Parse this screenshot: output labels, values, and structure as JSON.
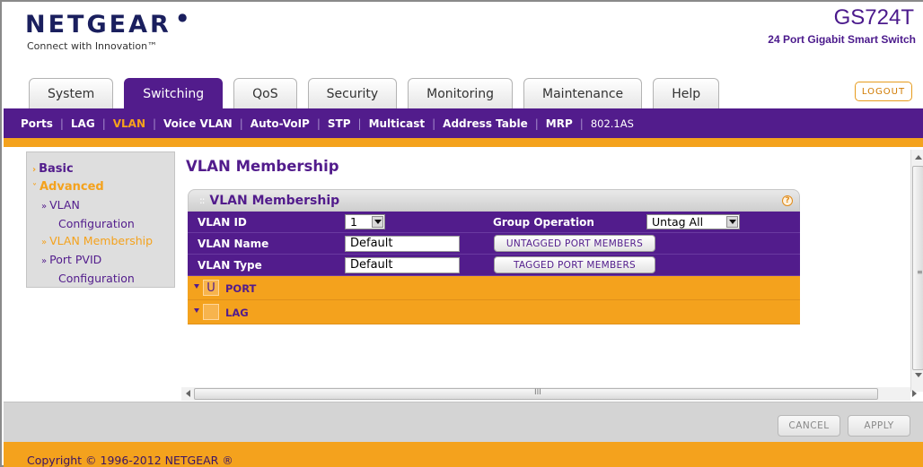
{
  "header": {
    "logo": "NETGEAR",
    "tagline": "Connect with Innovation™",
    "model": "GS724T",
    "model_desc": "24 Port Gigabit Smart Switch"
  },
  "tabs": [
    {
      "label": "System",
      "active": false
    },
    {
      "label": "Switching",
      "active": true
    },
    {
      "label": "QoS",
      "active": false
    },
    {
      "label": "Security",
      "active": false
    },
    {
      "label": "Monitoring",
      "active": false
    },
    {
      "label": "Maintenance",
      "active": false
    },
    {
      "label": "Help",
      "active": false
    }
  ],
  "logout_label": "LOGOUT",
  "subnav": [
    "Ports",
    "LAG",
    "VLAN",
    "Voice VLAN",
    "Auto-VoIP",
    "STP",
    "Multicast",
    "Address Table",
    "MRP",
    "802.1AS"
  ],
  "subnav_active": "VLAN",
  "leftnav": {
    "basic": "Basic",
    "advanced": "Advanced",
    "items": [
      {
        "label1": "VLAN",
        "label2": "Configuration",
        "current": false
      },
      {
        "label1": "VLAN Membership",
        "label2": "",
        "current": true
      },
      {
        "label1": "Port PVID",
        "label2": "Configuration",
        "current": false
      }
    ]
  },
  "page_title": "VLAN Membership",
  "panel": {
    "title": "VLAN Membership",
    "vlan_id_label": "VLAN ID",
    "vlan_id_value": "1",
    "group_op_label": "Group Operation",
    "group_op_value": "Untag All",
    "vlan_name_label": "VLAN Name",
    "vlan_name_value": "Default",
    "untagged_btn": "UNTAGGED PORT MEMBERS",
    "vlan_type_label": "VLAN Type",
    "vlan_type_value": "Default",
    "tagged_btn": "TAGGED PORT MEMBERS",
    "port_row_badge": "U",
    "port_row_label": "PORT",
    "lag_row_label": "LAG"
  },
  "buttons": {
    "cancel": "CANCEL",
    "apply": "APPLY"
  },
  "copyright": "Copyright © 1996-2012 NETGEAR ®",
  "colors": {
    "brand_purple": "#521c8c",
    "brand_orange": "#f4a21d"
  }
}
